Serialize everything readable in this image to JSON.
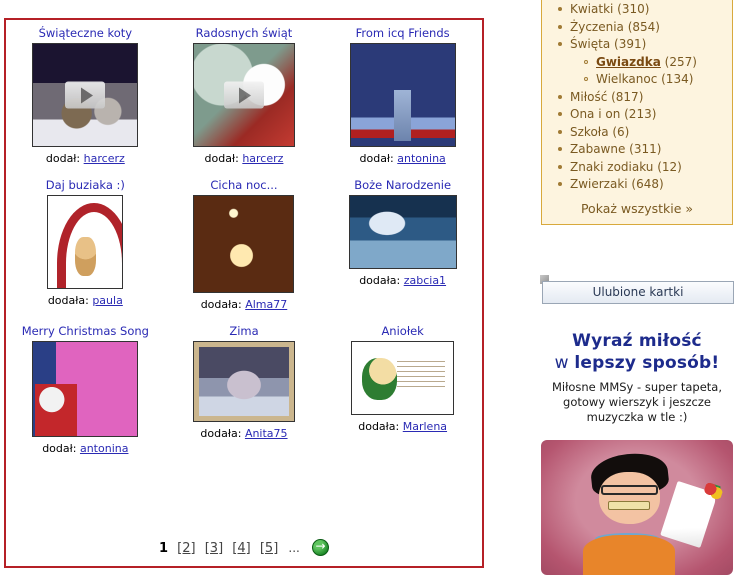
{
  "cards": {
    "rows": [
      [
        {
          "title": "Świąteczne koty",
          "credit_prefix": "dodał:",
          "author": "harcerz",
          "art": "art-cats",
          "has_play": true,
          "w": 106,
          "h": 104
        },
        {
          "title": "Radosnych świąt",
          "credit_prefix": "dodał:",
          "author": "harcerz",
          "art": "art-snowman",
          "has_play": true,
          "w": 102,
          "h": 104
        },
        {
          "title": "From icq Friends",
          "credit_prefix": "dodał:",
          "author": "antonina",
          "art": "art-deer",
          "has_play": false,
          "w": 106,
          "h": 104
        }
      ],
      [
        {
          "title": "Daj buziaka :)",
          "credit_prefix": "dodała:",
          "author": "paula",
          "art": "art-teddy",
          "has_play": false,
          "w": 76,
          "h": 94
        },
        {
          "title": "Cicha noc...",
          "credit_prefix": "dodała:",
          "author": "Alma77",
          "art": "art-nativity",
          "has_play": false,
          "w": 101,
          "h": 98
        },
        {
          "title": "Boże Narodzenie",
          "credit_prefix": "dodała:",
          "author": "zabcia1",
          "art": "art-winter",
          "has_play": false,
          "w": 108,
          "h": 74
        }
      ],
      [
        {
          "title": "Merry Christmas Song",
          "credit_prefix": "dodał:",
          "author": "antonina",
          "art": "art-santa",
          "has_play": false,
          "w": 106,
          "h": 96
        },
        {
          "title": "Zima",
          "credit_prefix": "dodała:",
          "author": "Anita75",
          "art": "art-cottage",
          "has_play": false,
          "w": 102,
          "h": 81
        },
        {
          "title": "Aniołek",
          "credit_prefix": "dodała:",
          "author": "Marlena",
          "art": "art-angel",
          "has_play": false,
          "w": 103,
          "h": 74
        }
      ]
    ],
    "border_color": "#b52026"
  },
  "pagination": {
    "current": "1",
    "pages": [
      "[2]",
      "[3]",
      "[4]",
      "[5]"
    ],
    "ellipsis": "...",
    "next_icon": "arrow-right-circle-icon"
  },
  "sidebar": {
    "categories": [
      {
        "label": "Kwiatki (310)",
        "selected": false,
        "sub": []
      },
      {
        "label": "Życzenia (854)",
        "selected": false,
        "sub": []
      },
      {
        "label": "Święta (391)",
        "selected": false,
        "sub": [
          {
            "label": "Gwiazdka",
            "count": "(257)",
            "selected": true
          },
          {
            "label": "Wielkanoc",
            "count": "(134)",
            "selected": false
          }
        ]
      },
      {
        "label": "Miłość (817)",
        "selected": false,
        "sub": []
      },
      {
        "label": "Ona i on (213)",
        "selected": false,
        "sub": []
      },
      {
        "label": "Szkoła (6)",
        "selected": false,
        "sub": []
      },
      {
        "label": "Zabawne (311)",
        "selected": false,
        "sub": []
      },
      {
        "label": "Znaki zodiaku (12)",
        "selected": false,
        "sub": []
      },
      {
        "label": "Zwierzaki (648)",
        "selected": false,
        "sub": []
      }
    ],
    "show_all": "Pokaż wszystkie »",
    "panel_bg": "#fdf4df",
    "panel_border": "#d8a93c",
    "text_color": "#7a5a22"
  },
  "favourites": {
    "label": "Ulubione kartki",
    "tab_icon": "bookmark-tab-icon"
  },
  "promo": {
    "line1": "Wyraź miłość",
    "line2_light": "w ",
    "line2_bold": "lepszy sposób!",
    "desc": "Miłosne MMSy - super tapeta, gotowy wierszyk i jeszcze muzyczka w tle :)",
    "image_alt": "cartoon-man-with-flowers-image",
    "headline_color": "#1d2b8c"
  }
}
